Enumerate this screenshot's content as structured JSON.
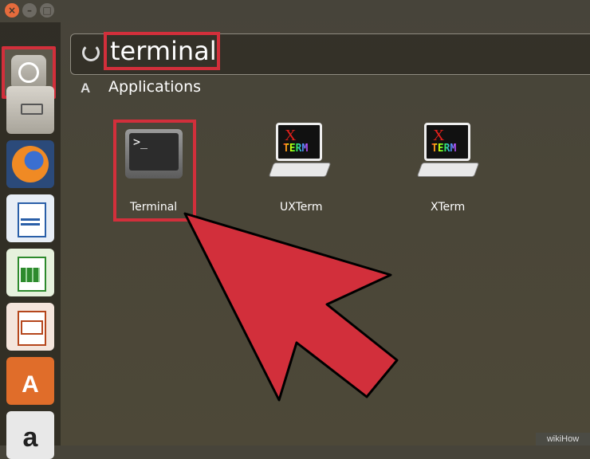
{
  "search": {
    "query": "terminal"
  },
  "category": {
    "label": "Applications"
  },
  "apps": [
    {
      "label": "Terminal"
    },
    {
      "label": "UXTerm",
      "icon_x": "X",
      "icon_term": "TERM"
    },
    {
      "label": "XTerm",
      "icon_x": "X",
      "icon_term": "TERM"
    }
  ],
  "launcher": {
    "items": [
      "dash-home",
      "files",
      "firefox",
      "libreoffice-writer",
      "libreoffice-calc",
      "libreoffice-impress",
      "ubuntu-software-center",
      "amazon"
    ]
  },
  "watermark": {
    "text": "wikiHow"
  },
  "colors": {
    "highlight": "#d22f3b",
    "arrow": "#d22f3b",
    "background": "#4a4638"
  }
}
